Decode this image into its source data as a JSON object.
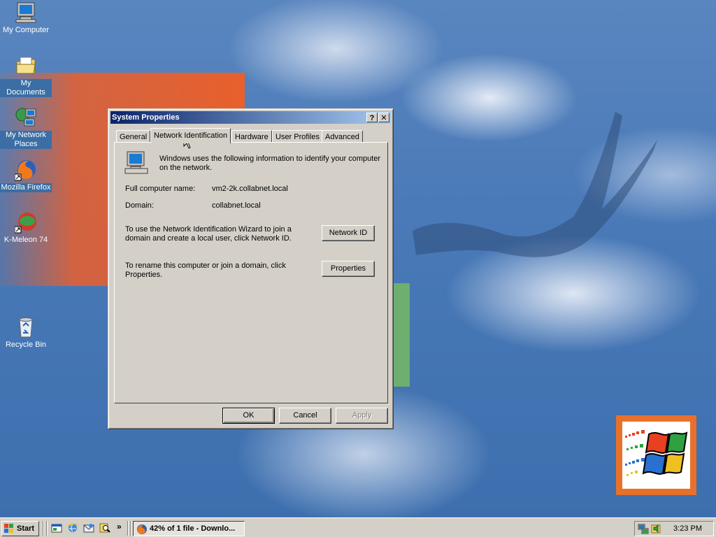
{
  "desktop": {
    "icons": [
      {
        "label": "My Computer",
        "icon": "my-computer-icon"
      },
      {
        "label": "My Documents",
        "icon": "folder-documents-icon"
      },
      {
        "label": "My Network Places",
        "icon": "network-places-icon"
      },
      {
        "label": "Mozilla Firefox",
        "icon": "firefox-icon"
      },
      {
        "label": "K-Meleon 74",
        "icon": "k-meleon-icon"
      },
      {
        "label": "Recycle Bin",
        "icon": "recycle-bin-icon"
      }
    ]
  },
  "dialog": {
    "title": "System Properties",
    "help_label": "?",
    "close_label": "✕",
    "tabs": [
      {
        "label": "General",
        "active": false
      },
      {
        "label": "Network Identification",
        "active": true
      },
      {
        "label": "Hardware",
        "active": false
      },
      {
        "label": "User Profiles",
        "active": false
      },
      {
        "label": "Advanced",
        "active": false
      }
    ],
    "intro": "Windows uses the following information to identify your computer on the network.",
    "full_name_label": "Full computer name:",
    "full_name_value": "vm2-2k.collabnet.local",
    "domain_label": "Domain:",
    "domain_value": "collabnet.local",
    "network_id_text": "To use the Network Identification Wizard to join a domain and create a local user, click Network ID.",
    "network_id_button": "Network ID",
    "properties_text": "To rename this computer or join a domain, click Properties.",
    "properties_button": "Properties",
    "ok_button": "OK",
    "cancel_button": "Cancel",
    "apply_button": "Apply"
  },
  "taskbar": {
    "start_label": "Start",
    "more_label": "»",
    "task_label": "42% of 1 file - Downlo...",
    "clock": "3:23 PM"
  },
  "colors": {
    "titlebar_start": "#0a246a",
    "titlebar_end": "#a6caf0",
    "desktop": "#4a7ab8",
    "face": "#d4d0c8"
  }
}
